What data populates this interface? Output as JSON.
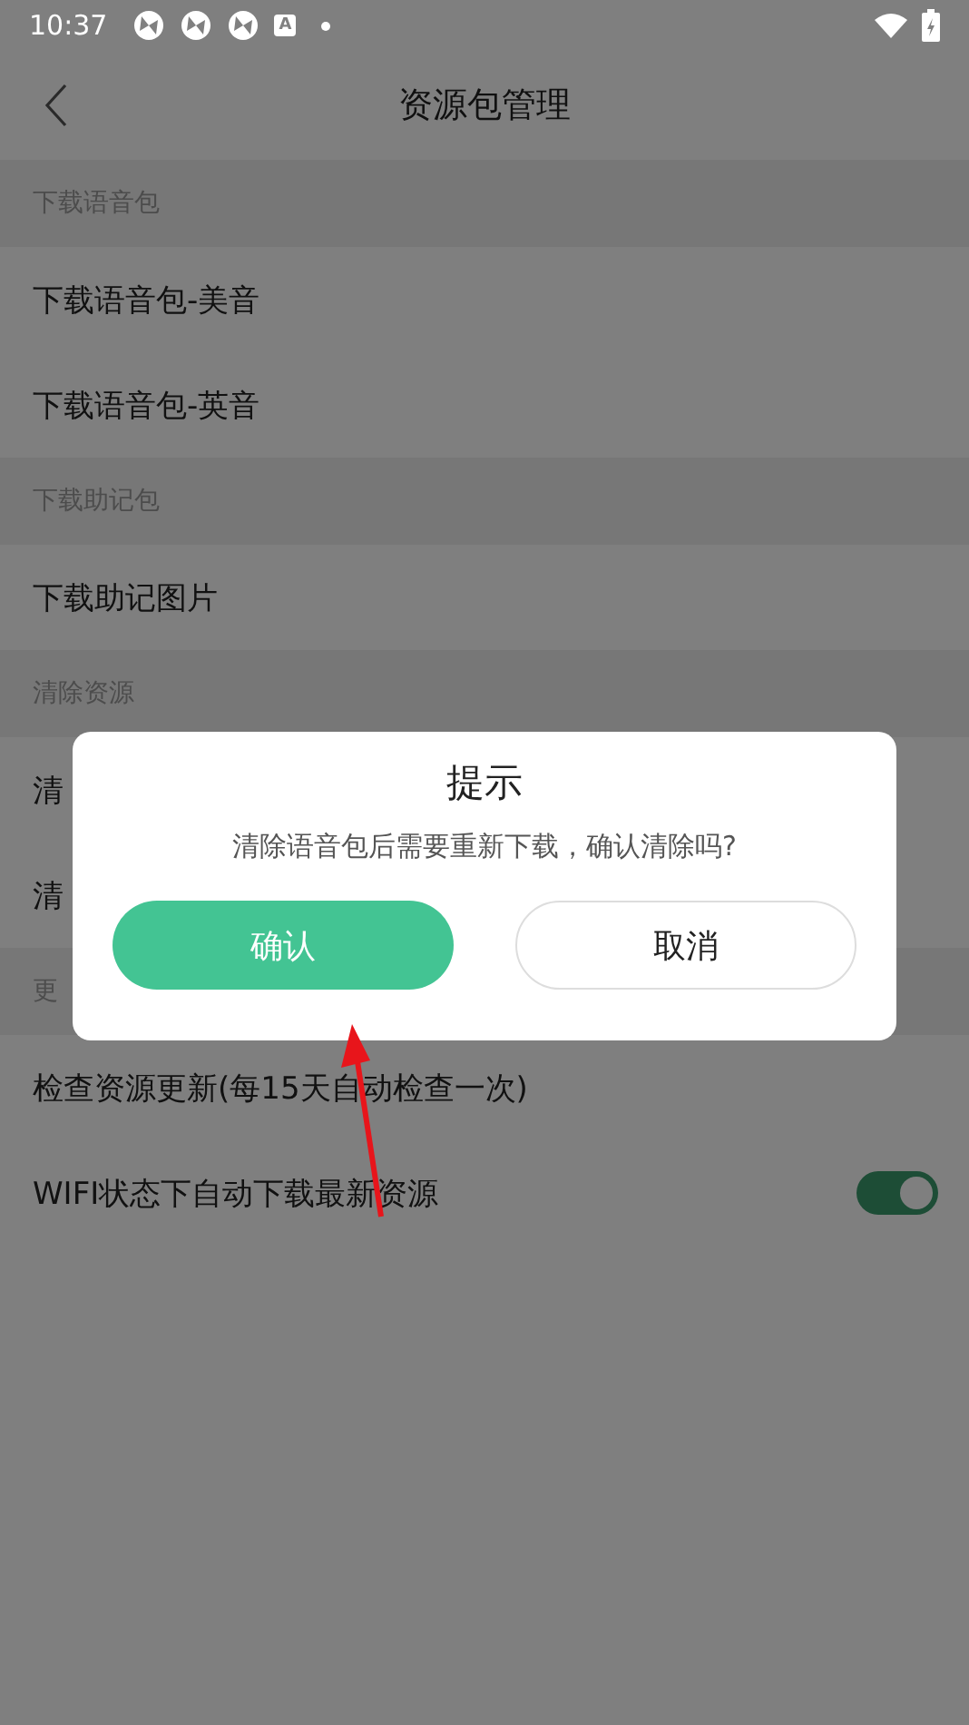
{
  "status_bar": {
    "time": "10:37",
    "notification_icons": [
      {
        "kind": "aperture"
      },
      {
        "kind": "aperture"
      },
      {
        "kind": "aperture"
      },
      {
        "kind": "letter",
        "text": "A"
      },
      {
        "kind": "dot"
      }
    ]
  },
  "header": {
    "title": "资源包管理"
  },
  "sections": [
    {
      "title": "下载语音包",
      "rows": [
        {
          "kind": "text",
          "label": "下载语音包-美音"
        },
        {
          "kind": "text",
          "label": "下载语音包-英音"
        }
      ]
    },
    {
      "title": "下载助记包",
      "rows": [
        {
          "kind": "text",
          "label": "下载助记图片"
        }
      ]
    },
    {
      "title": "清除资源",
      "rows": [
        {
          "kind": "text",
          "label": "清"
        },
        {
          "kind": "text",
          "label": "清"
        }
      ]
    },
    {
      "title": "更",
      "rows": [
        {
          "kind": "text",
          "label": "检查资源更新(每15天自动检查一次)"
        },
        {
          "kind": "toggle",
          "label": "WIFI状态下自动下载最新资源",
          "on": true
        }
      ]
    }
  ],
  "dialog": {
    "title": "提示",
    "message": "清除语音包后需要重新下载，确认清除吗?",
    "buttons": [
      {
        "kind": "primary",
        "label": "确认"
      },
      {
        "kind": "secondary",
        "label": "取消"
      }
    ]
  },
  "annotations": [
    {
      "kind": "arrow"
    }
  ]
}
